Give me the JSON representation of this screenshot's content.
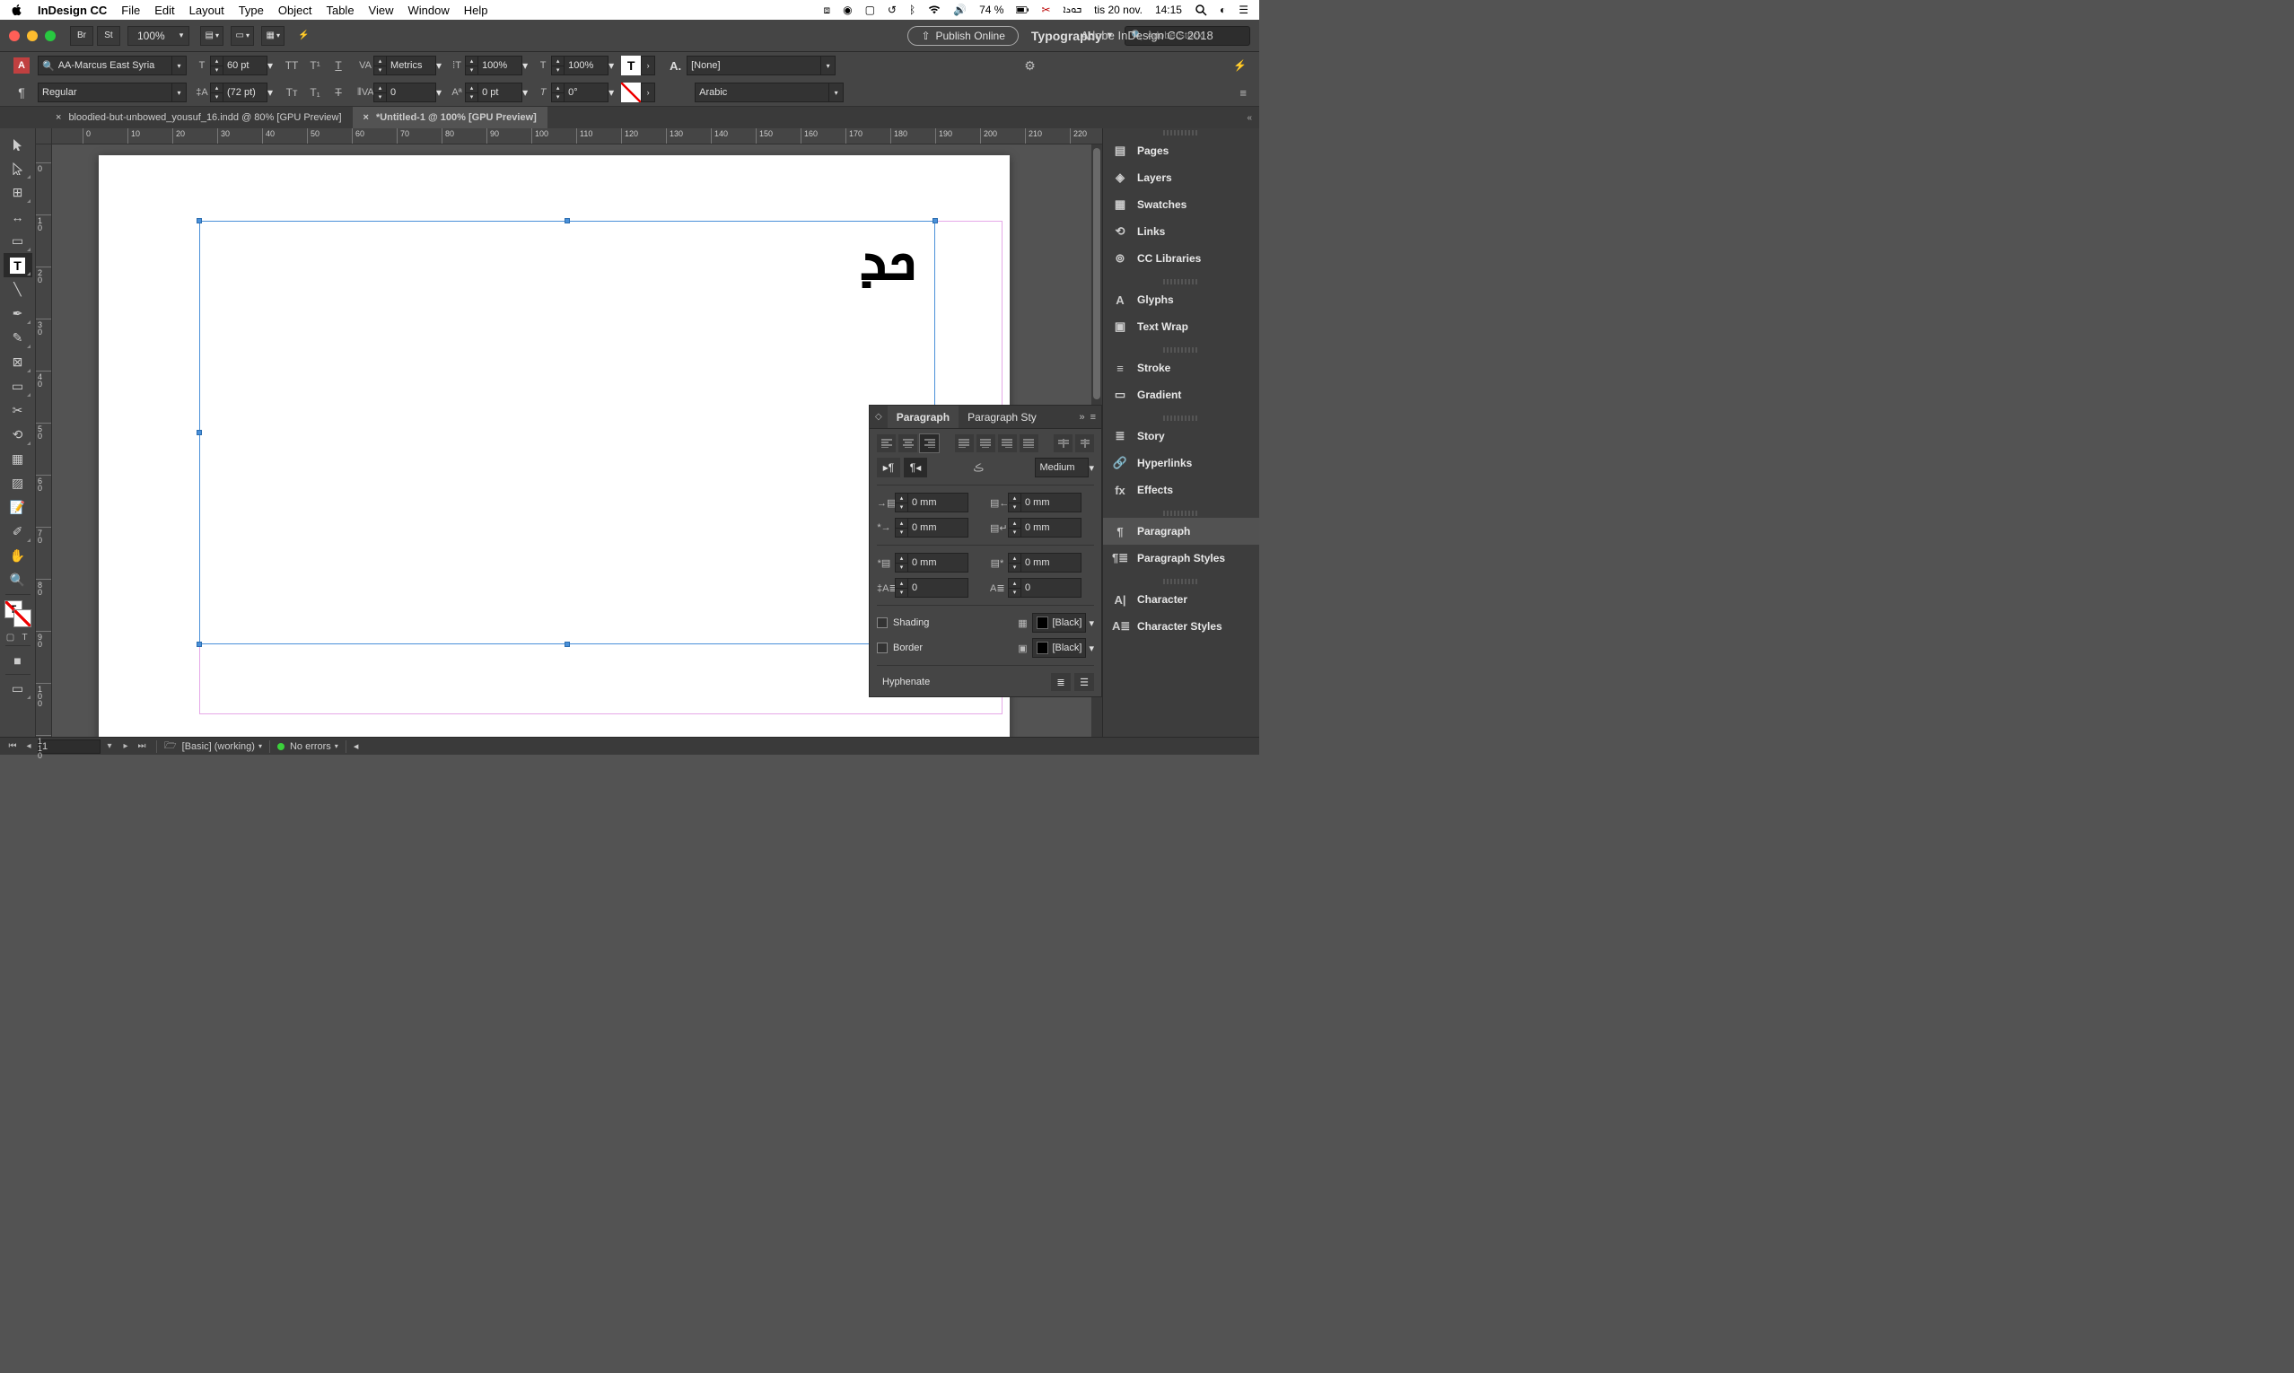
{
  "mac_menu": {
    "app": "InDesign CC",
    "items": [
      "File",
      "Edit",
      "Layout",
      "Type",
      "Object",
      "Table",
      "View",
      "Window",
      "Help"
    ],
    "battery": "74 %",
    "date": "tis 20 nov.",
    "time": "14:15",
    "extra": "ܒܘܖܐ"
  },
  "chrome": {
    "zoom": "100%",
    "doc_title": "Adobe InDesign CC 2018",
    "publish": "Publish Online",
    "workspace": "Typography",
    "search_placeholder": "Adobe Stock",
    "br": "Br",
    "st": "St"
  },
  "ctrl": {
    "font": "AA-Marcus East Syria",
    "style": "Regular",
    "size": "60 pt",
    "leading": "(72 pt)",
    "kerning": "Metrics",
    "tracking": "0",
    "vscale": "100%",
    "hscale": "100%",
    "baseline": "0 pt",
    "skew": "0°",
    "char_style": "[None]",
    "lang": "Arabic",
    "a_label": "A.",
    "T_btn": "T"
  },
  "doc_tabs": {
    "tab1": "bloodied-but-unbowed_yousuf_16.indd @ 80% [GPU Preview]",
    "tab2": "*Untitled-1 @ 100% [GPU Preview]"
  },
  "rulers": {
    "h": [
      "0",
      "10",
      "20",
      "30",
      "40",
      "50",
      "60",
      "70",
      "80",
      "90",
      "100",
      "110",
      "120",
      "130",
      "140",
      "150",
      "160",
      "170",
      "180",
      "190",
      "200",
      "210",
      "220"
    ],
    "v": [
      "0",
      "10",
      "20",
      "30",
      "40",
      "50",
      "60",
      "70",
      "80",
      "90",
      "100",
      "110"
    ]
  },
  "canvas": {
    "text": "ܟܕ"
  },
  "para_panel": {
    "tab1": "Paragraph",
    "tab2": "Paragraph Sty",
    "kashida": "Medium",
    "left_indent": "0 mm",
    "right_indent": "0 mm",
    "first_indent": "0 mm",
    "last_indent": "0 mm",
    "space_before": "0 mm",
    "space_after": "0 mm",
    "drop_lines": "0",
    "drop_chars": "0",
    "shading_label": "Shading",
    "shading_color": "[Black]",
    "border_label": "Border",
    "border_color": "[Black]",
    "hyphenate": "Hyphenate"
  },
  "right_dock": {
    "groups": [
      [
        "Pages",
        "Layers",
        "Swatches",
        "Links",
        "CC Libraries"
      ],
      [
        "Glyphs",
        "Text Wrap"
      ],
      [
        "Stroke",
        "Gradient"
      ],
      [
        "Story",
        "Hyperlinks",
        "Effects"
      ],
      [
        "Paragraph",
        "Paragraph Styles"
      ],
      [
        "Character",
        "Character Styles"
      ]
    ],
    "active": "Paragraph"
  },
  "status": {
    "page": "1",
    "style": "[Basic] (working)",
    "errors": "No errors"
  }
}
